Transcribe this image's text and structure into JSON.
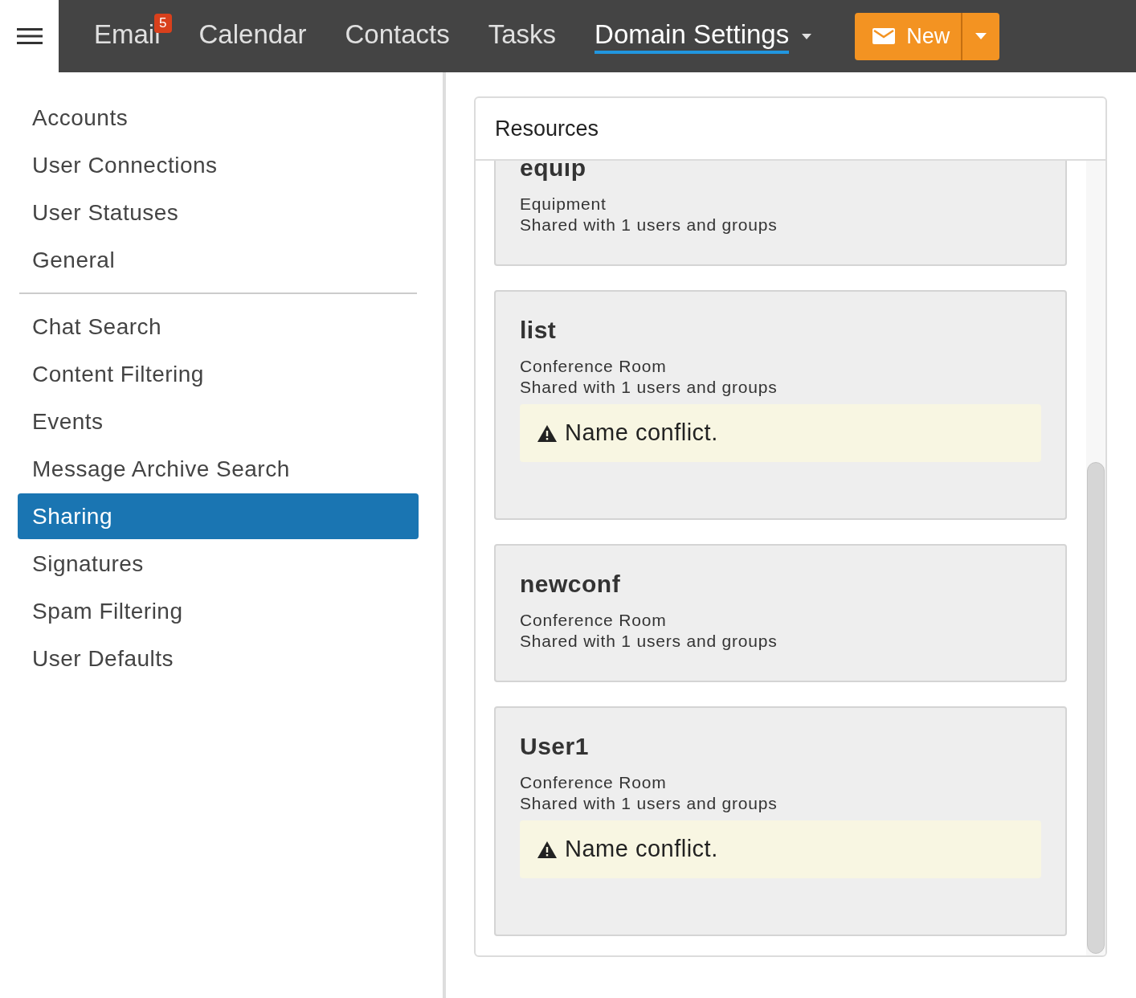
{
  "nav": {
    "tabs": [
      {
        "label": "Email",
        "selected": false,
        "badge": "5"
      },
      {
        "label": "Calendar",
        "selected": false
      },
      {
        "label": "Contacts",
        "selected": false
      },
      {
        "label": "Tasks",
        "selected": false
      },
      {
        "label": "Domain Settings",
        "selected": true,
        "dropdown": true
      }
    ],
    "new_button": {
      "label": "New"
    }
  },
  "sidebar": {
    "groups": [
      [
        {
          "label": "Accounts",
          "selected": false
        },
        {
          "label": "User Connections",
          "selected": false
        },
        {
          "label": "User Statuses",
          "selected": false
        },
        {
          "label": "General",
          "selected": false
        }
      ],
      [
        {
          "label": "Chat Search",
          "selected": false
        },
        {
          "label": "Content Filtering",
          "selected": false
        },
        {
          "label": "Events",
          "selected": false
        },
        {
          "label": "Message Archive Search",
          "selected": false
        },
        {
          "label": "Sharing",
          "selected": true
        },
        {
          "label": "Signatures",
          "selected": false
        },
        {
          "label": "Spam Filtering",
          "selected": false
        },
        {
          "label": "User Defaults",
          "selected": false
        }
      ]
    ]
  },
  "panel": {
    "title": "Resources",
    "cards": [
      {
        "name": "equip",
        "type": "Equipment",
        "shared": "Shared with 1 users and groups"
      },
      {
        "name": "list",
        "type": "Conference Room",
        "shared": "Shared with 1 users and groups",
        "warning": "Name conflict."
      },
      {
        "name": "newconf",
        "type": "Conference Room",
        "shared": "Shared with 1 users and groups"
      },
      {
        "name": "User1",
        "type": "Conference Room",
        "shared": "Shared with 1 users and groups",
        "warning": "Name conflict."
      }
    ]
  }
}
